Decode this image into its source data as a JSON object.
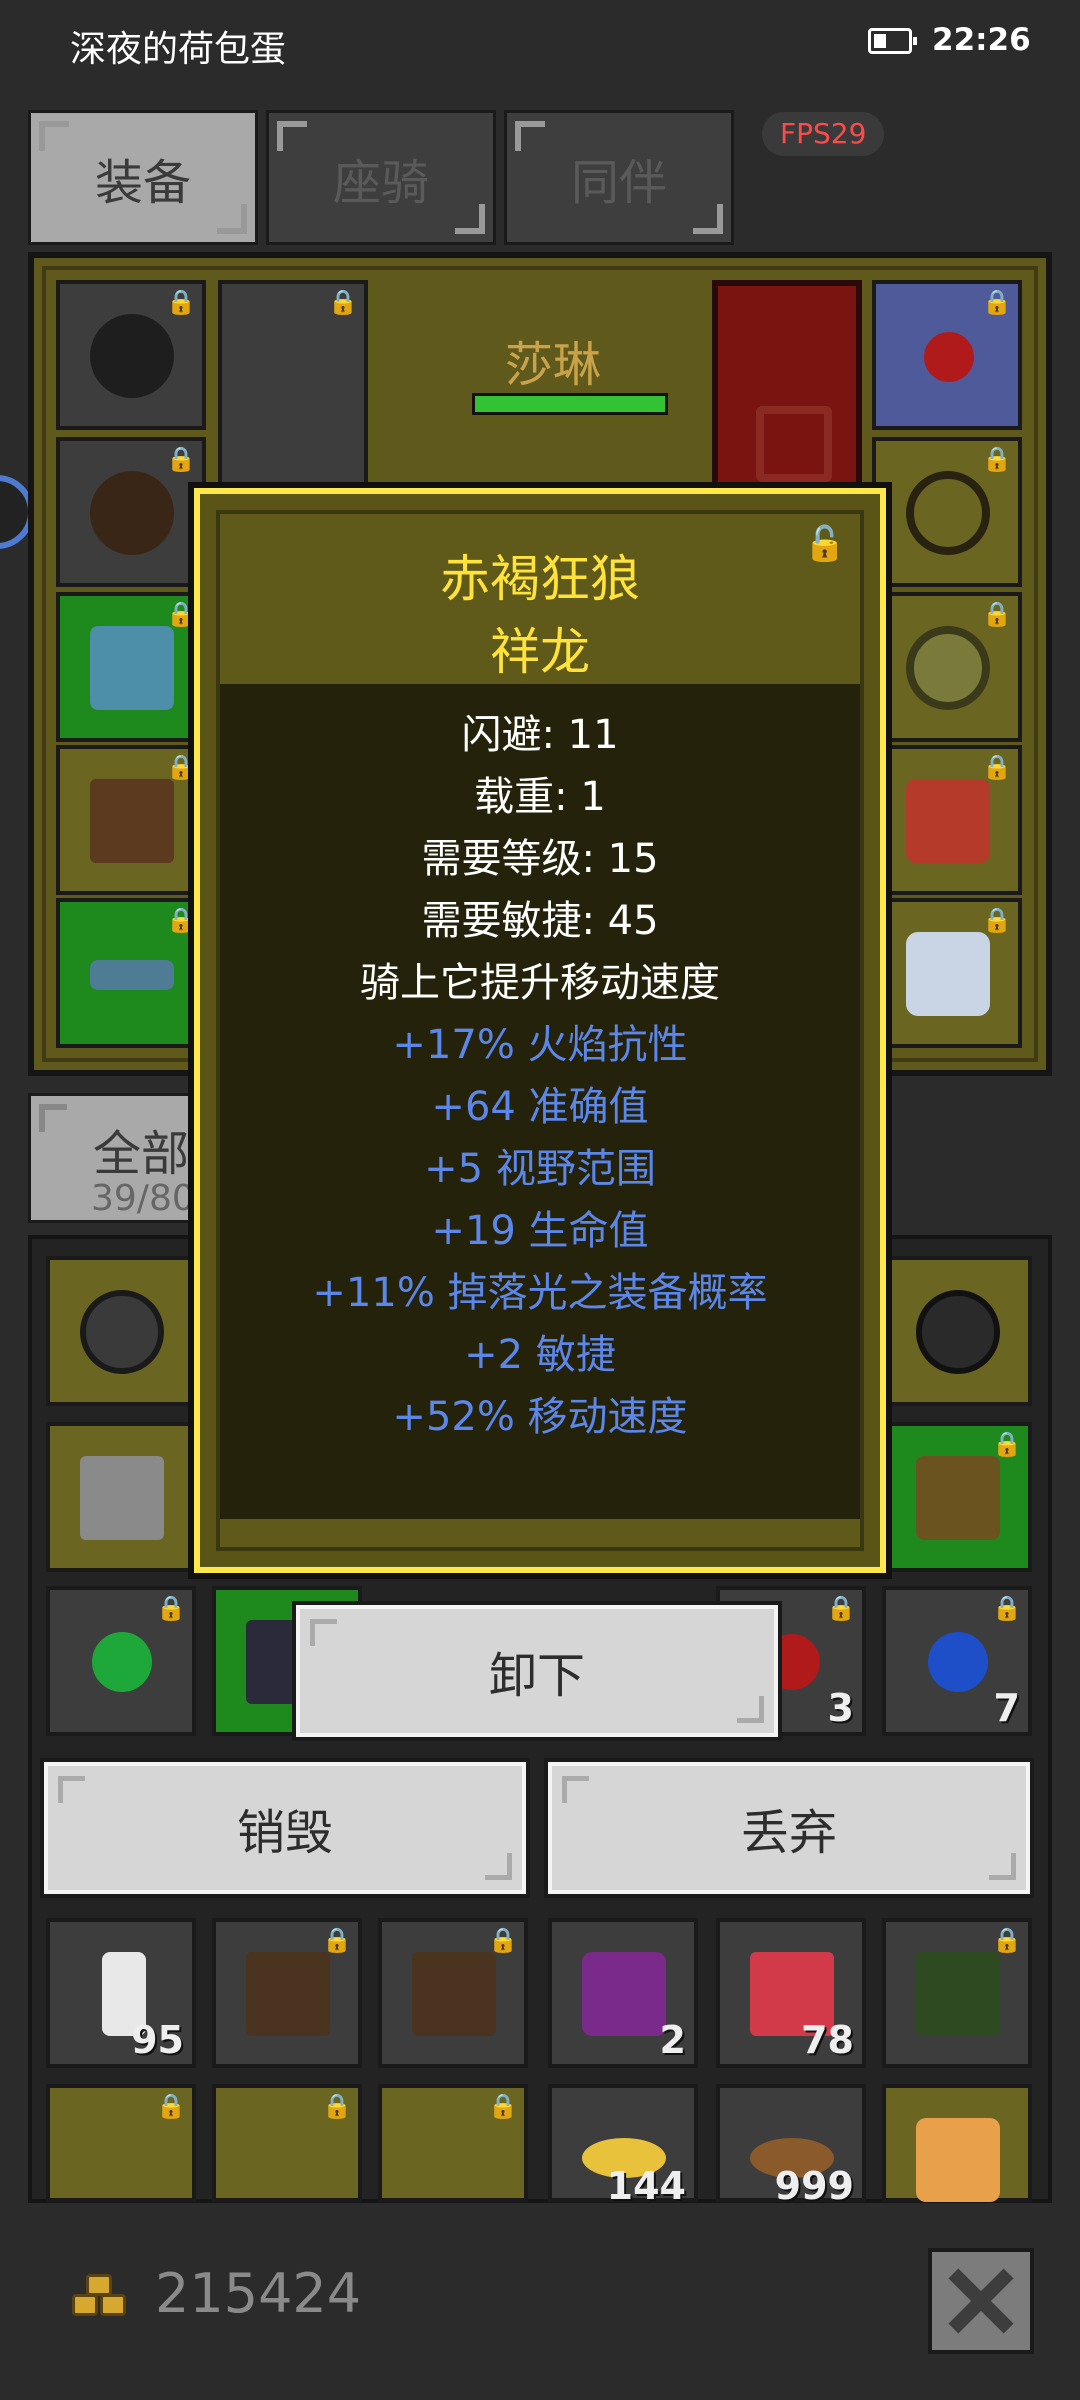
{
  "status_bar": {
    "title": "深夜的荷包蛋",
    "time": "22:26"
  },
  "tabs": [
    {
      "label": "装备",
      "active": true
    },
    {
      "label": "座骑",
      "active": false
    },
    {
      "label": "同伴",
      "active": false
    }
  ],
  "fps_label": "FPS29",
  "character": {
    "name": "莎琳",
    "hp_fraction": 1.0
  },
  "bag": {
    "tab_label": "全部",
    "tab_count": "39/80"
  },
  "tooltip": {
    "title": "赤褐狂狼",
    "subtitle": "祥龙",
    "stats": [
      {
        "text": "闪避: 11",
        "color": "white"
      },
      {
        "text": "载重: 1",
        "color": "white"
      },
      {
        "text": "需要等级: 15",
        "color": "white"
      },
      {
        "text": "需要敏捷: 45",
        "color": "white"
      },
      {
        "text": "骑上它提升移动速度",
        "color": "white"
      },
      {
        "text": "+17% 火焰抗性",
        "color": "blue"
      },
      {
        "text": "+64 准确值",
        "color": "blue"
      },
      {
        "text": "+5 视野范围",
        "color": "blue"
      },
      {
        "text": "+19 生命值",
        "color": "blue"
      },
      {
        "text": "+11% 掉落光之装备概率",
        "color": "blue"
      },
      {
        "text": "+2 敏捷",
        "color": "blue"
      },
      {
        "text": "+52% 移动速度",
        "color": "blue"
      }
    ]
  },
  "actions": {
    "unequip": "卸下",
    "destroy": "销毁",
    "discard": "丢弃"
  },
  "item_counts": {
    "slot_r1c5": "3",
    "slot_r1c6": "7",
    "potion": "95",
    "scroll": "2",
    "gift": "78",
    "stone": "144",
    "pouch": "999"
  },
  "gold": "215424",
  "colors": {
    "accent_yellow": "#ffe33a",
    "stat_blue": "#5b86ea",
    "fps_red": "#ff4a4a"
  }
}
